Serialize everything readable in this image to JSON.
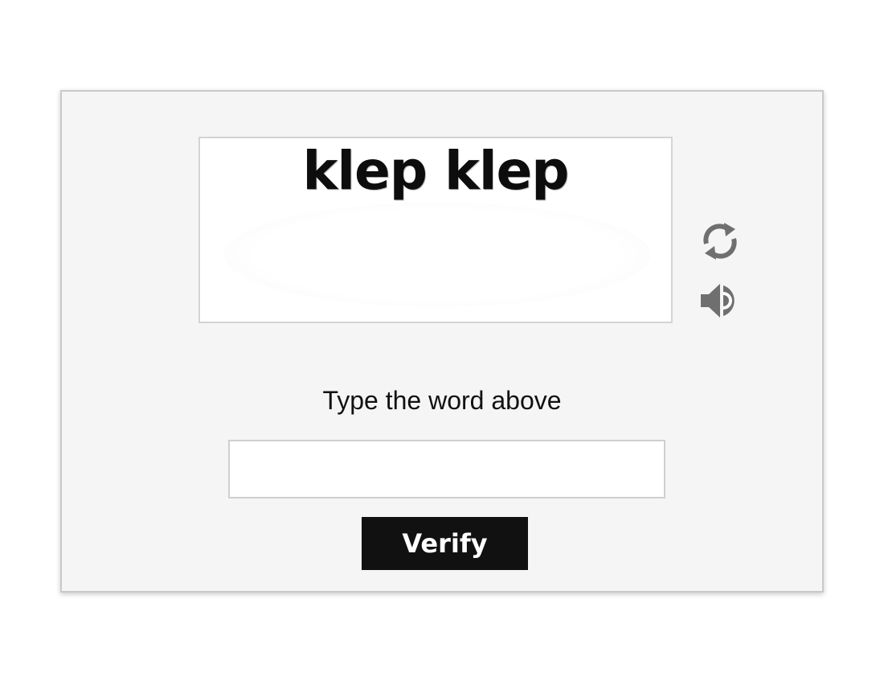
{
  "captcha": {
    "word": "klep klep",
    "refresh_icon": "refresh-icon",
    "audio_icon": "speaker-icon"
  },
  "form": {
    "prompt": "Type the word above",
    "answer_value": "",
    "answer_placeholder": "",
    "verify_label": "Verify"
  },
  "colors": {
    "panel_bg": "#f5f5f5",
    "button_bg": "#111111",
    "icon_gray": "#6f6f6f"
  }
}
